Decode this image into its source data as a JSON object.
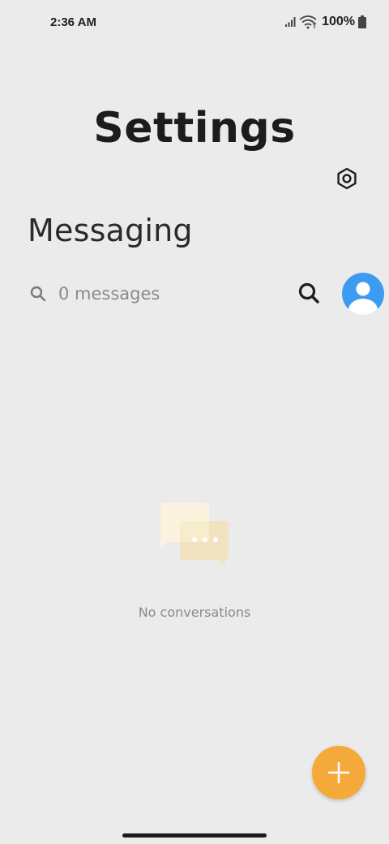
{
  "status_bar": {
    "time": "2:36 AM",
    "battery": "100%",
    "icons": [
      "signal-icon",
      "wifi-icon",
      "battery-icon"
    ]
  },
  "header": {
    "title": "Settings",
    "settings_icon": "gear-icon"
  },
  "section": {
    "title": "Messaging"
  },
  "search": {
    "icon": "search-icon",
    "text": "0 messages",
    "button_icon": "search-icon"
  },
  "profile": {
    "icon": "avatar-icon",
    "color": "#3d9cf0"
  },
  "empty_state": {
    "icon": "chat-bubbles-icon",
    "text": "No conversations"
  },
  "fab": {
    "icon": "plus-icon",
    "color": "#f5a93a"
  }
}
